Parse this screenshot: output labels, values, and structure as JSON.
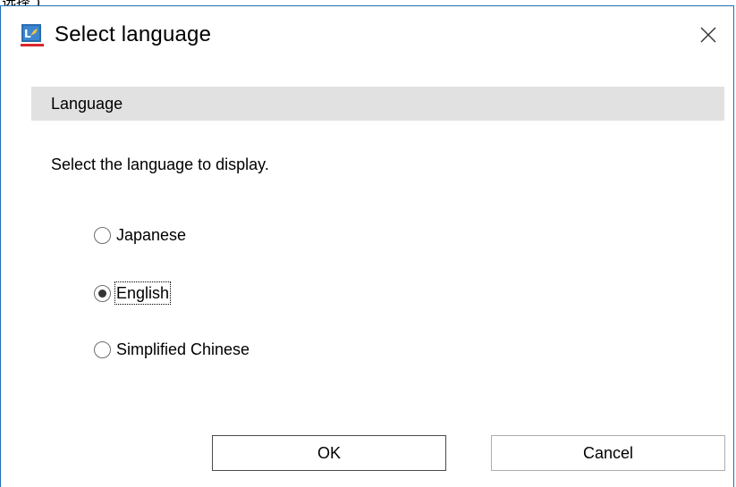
{
  "dialog": {
    "title": "Select language",
    "close_icon": "close-icon",
    "app_icon": "app-icon",
    "accent_color": "#1f6fb5"
  },
  "section": {
    "header": "Language",
    "instruction": "Select the language to display."
  },
  "languages": {
    "options": [
      {
        "label": "Japanese",
        "checked": false
      },
      {
        "label": "English",
        "checked": true
      },
      {
        "label": "Simplified Chinese",
        "checked": false
      }
    ],
    "selected": "English"
  },
  "buttons": {
    "ok_label": "OK",
    "cancel_label": "Cancel"
  }
}
